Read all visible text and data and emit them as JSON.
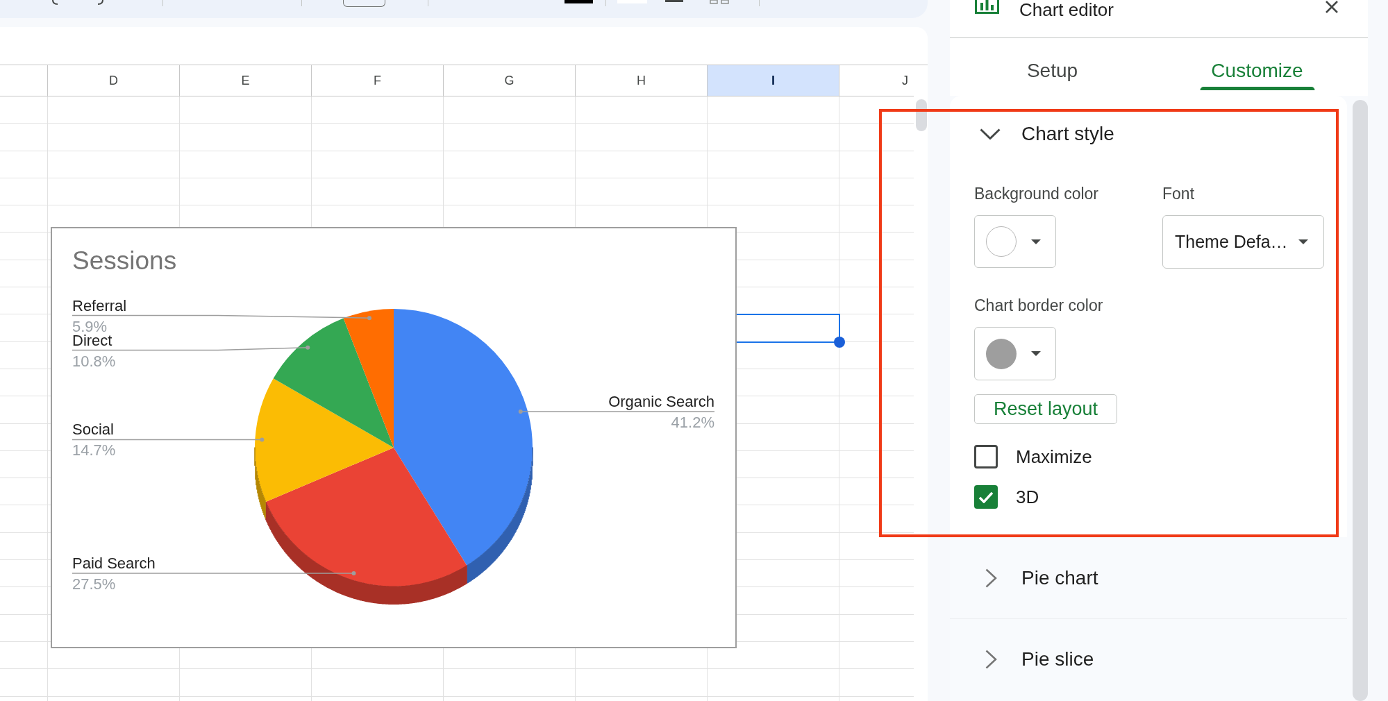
{
  "sheet": {
    "columns": [
      {
        "label": "D",
        "selected": false
      },
      {
        "label": "E",
        "selected": false
      },
      {
        "label": "F",
        "selected": false
      },
      {
        "label": "G",
        "selected": false
      },
      {
        "label": "H",
        "selected": false
      },
      {
        "label": "I",
        "selected": true
      },
      {
        "label": "J",
        "selected": false
      }
    ]
  },
  "chart": {
    "chart_data": {
      "type": "pie",
      "title": "Sessions",
      "categories": [
        "Organic Search",
        "Paid Search",
        "Social",
        "Direct",
        "Referral"
      ],
      "values": [
        41.2,
        27.5,
        14.7,
        10.8,
        5.9
      ],
      "value_labels": [
        "41.2%",
        "27.5%",
        "14.7%",
        "10.8%",
        "5.9%"
      ]
    }
  },
  "chart_editor": {
    "title": "Chart editor",
    "tabs": [
      {
        "label": "Setup",
        "selected": false
      },
      {
        "label": "Customize",
        "selected": true
      }
    ],
    "sections": [
      {
        "title": "Chart style",
        "expanded": true,
        "background_color": {
          "label": "Background color",
          "color": "#ffffff"
        },
        "font": {
          "label": "Font",
          "value": "Theme Defa…"
        },
        "border_color": {
          "label": "Chart border color",
          "color": "#9e9e9e"
        },
        "reset_button": "Reset layout",
        "checkboxes": [
          {
            "label": "Maximize",
            "checked": false
          },
          {
            "label": "3D",
            "checked": true
          }
        ]
      },
      {
        "title": "Pie chart",
        "expanded": false
      },
      {
        "title": "Pie slice",
        "expanded": false
      }
    ]
  }
}
